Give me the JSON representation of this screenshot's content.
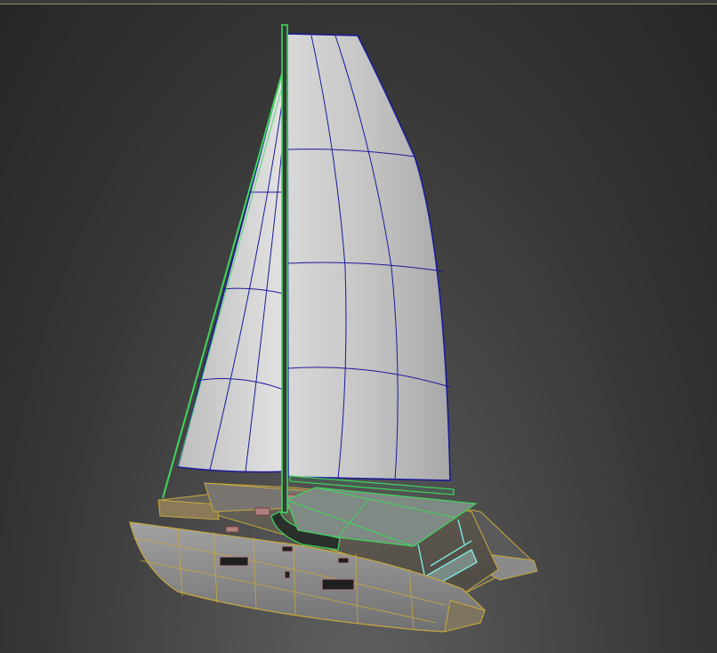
{
  "viewport": {
    "background_colors": [
      "#616161",
      "#4a4a4a",
      "#363636",
      "#262626"
    ],
    "frame_color": "#9a8a62"
  },
  "model": {
    "sail_color": "#c9c9c9",
    "sail_edge_color": "#1a1a9a",
    "rigging_color": "#3fd65c",
    "hull_color": "#8f8f8f",
    "hull_edge_color": "#c8a83c",
    "bimini_color": "#7f8a84",
    "railing_color": "#7fe8e0"
  }
}
